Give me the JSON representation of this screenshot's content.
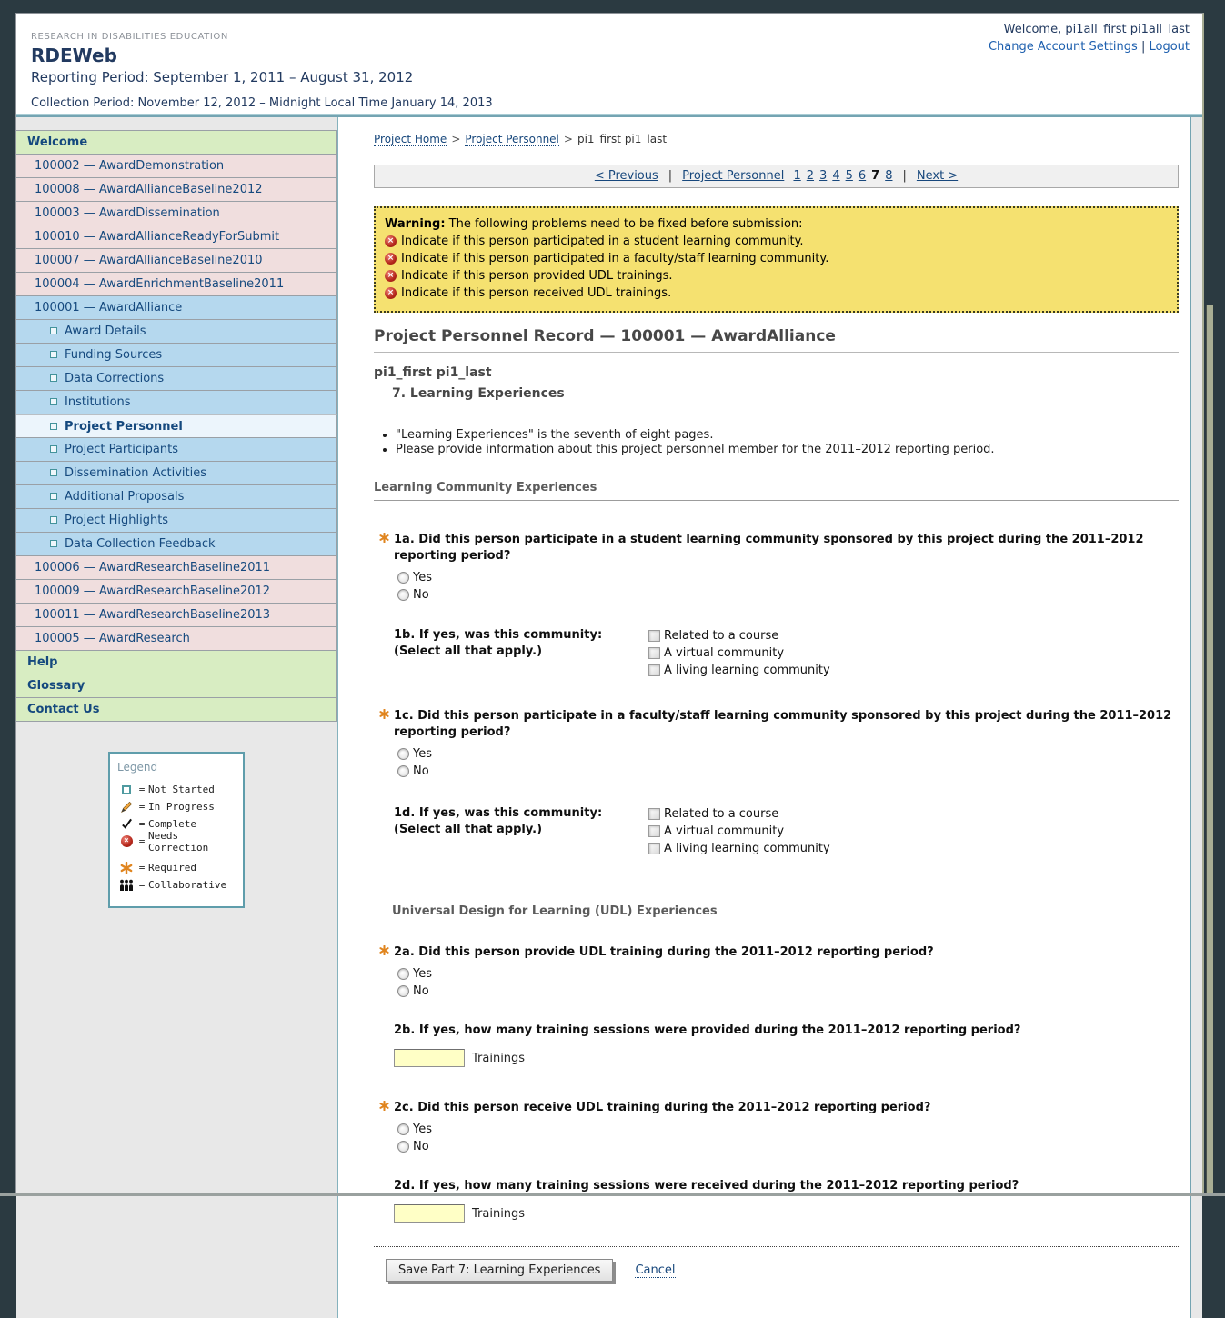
{
  "header": {
    "eyebrow": "RESEARCH IN DISABILITIES EDUCATION",
    "title": "RDEWeb",
    "reporting_period": "Reporting Period: September 1, 2011 – August 31, 2012",
    "collection_period": "Collection Period: November 12, 2012 – Midnight Local Time January 14, 2013",
    "welcome": "Welcome, pi1all_first pi1all_last",
    "account_settings_label": "Change Account Settings",
    "link_separator": "|",
    "logout_label": "Logout"
  },
  "sidebar": {
    "items": [
      {
        "label": "Welcome",
        "type": "header"
      },
      {
        "label": "100002 — AwardDemonstration",
        "type": "award"
      },
      {
        "label": "100008 — AwardAllianceBaseline2012",
        "type": "award"
      },
      {
        "label": "100003 — AwardDissemination",
        "type": "award"
      },
      {
        "label": "100010 — AwardAllianceReadyForSubmit",
        "type": "award"
      },
      {
        "label": "100007 — AwardAllianceBaseline2010",
        "type": "award"
      },
      {
        "label": "100004 — AwardEnrichmentBaseline2011",
        "type": "award"
      },
      {
        "label": "100001 — AwardAlliance",
        "type": "award-open"
      },
      {
        "label": "Award Details",
        "type": "sub"
      },
      {
        "label": "Funding Sources",
        "type": "sub"
      },
      {
        "label": "Data Corrections",
        "type": "sub"
      },
      {
        "label": "Institutions",
        "type": "sub"
      },
      {
        "label": "Project Personnel",
        "type": "sub-selected"
      },
      {
        "label": "Project Participants",
        "type": "sub"
      },
      {
        "label": "Dissemination Activities",
        "type": "sub"
      },
      {
        "label": "Additional Proposals",
        "type": "sub"
      },
      {
        "label": "Project Highlights",
        "type": "sub"
      },
      {
        "label": "Data Collection Feedback",
        "type": "sub"
      },
      {
        "label": "100006 — AwardResearchBaseline2011",
        "type": "award"
      },
      {
        "label": "100009 — AwardResearchBaseline2012",
        "type": "award"
      },
      {
        "label": "100011 — AwardResearchBaseline2013",
        "type": "award"
      },
      {
        "label": "100005 — AwardResearch",
        "type": "award"
      },
      {
        "label": "Help",
        "type": "header"
      },
      {
        "label": "Glossary",
        "type": "header"
      },
      {
        "label": "Contact Us",
        "type": "header"
      }
    ],
    "legend": {
      "title": "Legend",
      "equals": "=",
      "items": [
        {
          "icon": "not-started-icon",
          "label": "Not Started"
        },
        {
          "icon": "pencil-icon",
          "label": "In Progress"
        },
        {
          "icon": "check-icon",
          "label": "Complete"
        },
        {
          "icon": "needs-correction-icon",
          "label": "Needs Correction"
        },
        {
          "icon": "required-asterisk-icon",
          "label": "Required"
        },
        {
          "icon": "collaborative-people-icon",
          "label": "Collaborative"
        }
      ]
    }
  },
  "breadcrumb": {
    "links": [
      "Project Home",
      "Project Personnel"
    ],
    "separator": ">",
    "current": "pi1_first pi1_last"
  },
  "pagination": {
    "previous_label": "< Previous",
    "separator": "|",
    "section_label": "Project Personnel",
    "pages": [
      "1",
      "2",
      "3",
      "4",
      "5",
      "6",
      "7",
      "8"
    ],
    "current_page": "7",
    "next_label": "Next >"
  },
  "warning": {
    "title": "Warning:",
    "intro": " The following problems need to be fixed before submission:",
    "error_icon": "error-x-icon",
    "items": [
      "Indicate if this person participated in a student learning community.",
      "Indicate if this person participated in a faculty/staff learning community.",
      "Indicate if this person provided UDL trainings.",
      "Indicate if this person received UDL trainings."
    ]
  },
  "record": {
    "title": "Project Personnel Record — 100001 — AwardAlliance",
    "person": "pi1_first pi1_last",
    "part_title": "7. Learning Experiences",
    "notes": [
      "\"Learning Experiences\" is the seventh of eight pages.",
      "Please provide information about this project personnel member for the 2011–2012 reporting period."
    ]
  },
  "section1_title": "Learning Community Experiences",
  "section2_title": "Universal Design for Learning (UDL) Experiences",
  "q1a": {
    "label": "1a. Did this person participate in a student learning community sponsored by this project during the 2011–2012 reporting period?",
    "options": [
      "Yes",
      "No"
    ]
  },
  "q1b": {
    "label1": "1b. If yes, was this community:",
    "label2": "(Select all that apply.)",
    "options": [
      "Related to a course",
      "A virtual community",
      "A living learning community"
    ]
  },
  "q1c": {
    "label": "1c. Did this person participate in a faculty/staff learning community sponsored by this project during the 2011–2012 reporting period?",
    "options": [
      "Yes",
      "No"
    ]
  },
  "q1d": {
    "label1": "1d. If yes, was this community:",
    "label2": "(Select all that apply.)",
    "options": [
      "Related to a course",
      "A virtual community",
      "A living learning community"
    ]
  },
  "q2a": {
    "label": "2a. Did this person provide UDL training during the 2011–2012 reporting period?",
    "options": [
      "Yes",
      "No"
    ]
  },
  "q2b": {
    "label": "2b. If yes, how many training sessions were provided during the 2011–2012 reporting period?",
    "value": "",
    "unit": "Trainings"
  },
  "q2c": {
    "label": "2c. Did this person receive UDL training during the 2011–2012 reporting period?",
    "options": [
      "Yes",
      "No"
    ]
  },
  "q2d": {
    "label": "2d. If yes, how many training sessions were received during the 2011–2012 reporting period?",
    "value": "",
    "unit": "Trainings"
  },
  "footer": {
    "save_label": "Save Part 7: Learning Experiences",
    "cancel_label": "Cancel"
  },
  "colors": {
    "frame": "#2b3a41",
    "accent_teal": "#74a4b2",
    "nav_green": "#d8edc2",
    "nav_pink": "#f0dede",
    "nav_blue": "#b5d8ee",
    "nav_selected": "#ecf5fc",
    "link": "#17477c",
    "link_light": "#1d5fae",
    "warning_bg": "#f5e170",
    "error_red": "#b5281c",
    "required_orange": "#e0851f",
    "input_bg": "#ffffc6",
    "scrollbar_thumb": "#a9ae94"
  }
}
